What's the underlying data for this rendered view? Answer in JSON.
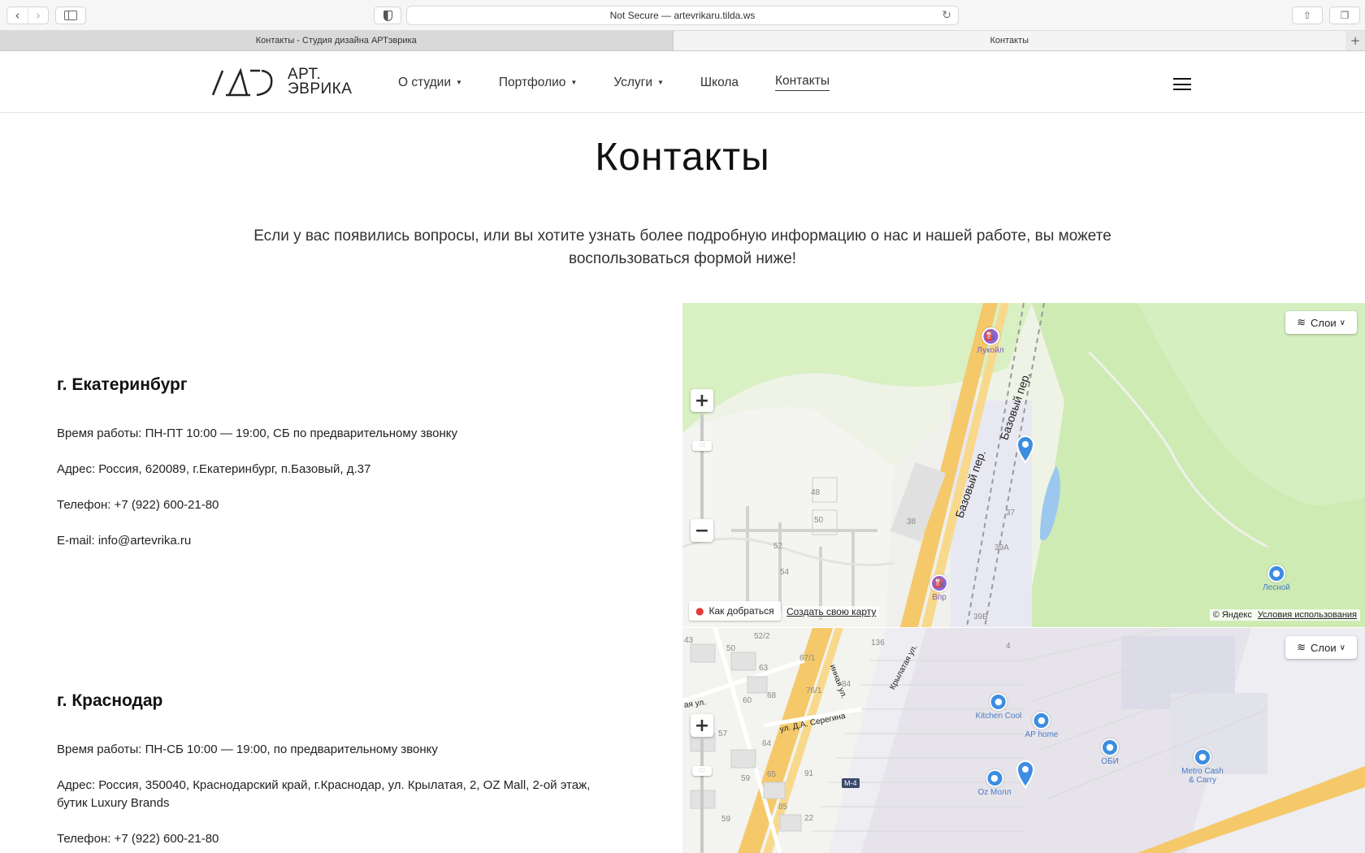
{
  "browser": {
    "url_text": "Not Secure — artevrikaru.tilda.ws",
    "tabs": [
      {
        "label": "Контакты - Студия дизайна АРТэврика",
        "active": false
      },
      {
        "label": "Контакты",
        "active": true
      }
    ],
    "new_tab": "+"
  },
  "header": {
    "logo_line1": "АРТ.",
    "logo_line2": "ЭВРИКА",
    "menu": [
      {
        "label": "О студии",
        "caret": "▼"
      },
      {
        "label": "Портфолио",
        "caret": "▼"
      },
      {
        "label": "Услуги",
        "caret": "▼"
      },
      {
        "label": "Школа",
        "caret": ""
      },
      {
        "label": "Контакты",
        "caret": ""
      }
    ]
  },
  "page": {
    "title": "Контакты",
    "intro": "Если у вас появились вопросы, или вы хотите узнать более подробную информацию о нас и нашей работе, вы можете воспользоваться формой ниже!"
  },
  "contacts": [
    {
      "city": "г. Екатеринбург",
      "hours": "Время работы: ПН-ПТ 10:00 — 19:00, СБ по предварительному звонку",
      "address": "Адрес: Россия, 620089, г.Екатеринбург, п.Базовый, д.37",
      "phone": "Телефон: +7 (922) 600-21-80",
      "email": "E-mail: info@artevrika.ru"
    },
    {
      "city": "г. Краснодар",
      "hours": "Время работы: ПН-СБ 10:00 — 19:00, по предварительному звонку",
      "address": "Адрес: Россия, 350040, Краснодарский край, г.Краснодар, ул. Крылатая, 2, OZ Mall, 2-ой этаж, бутик Luxury Brands",
      "phone": "Телефон: +7 (922) 600-21-80"
    }
  ],
  "map1": {
    "layers": "Слои",
    "route": "Как добраться",
    "create": "Создать свою карту",
    "copyright": "© Яндекс",
    "terms": "Условия использования",
    "streets": [
      "Базовый пер.",
      "Базовый пер."
    ],
    "pois": [
      "Лукойл",
      "Впр",
      "Лесной"
    ],
    "houses": [
      "48",
      "50",
      "38",
      "52",
      "54",
      "37",
      "39А",
      "39Б"
    ]
  },
  "map2": {
    "layers": "Слои",
    "streets": [
      "Крылатая ул.",
      "ул. Д.А. Серегина",
      "инная ул.",
      "ая ул."
    ],
    "pois": [
      "Kitchen Cool",
      "AP home",
      "ОБИ",
      "Metro Cash & Carry",
      "Oz Молл"
    ],
    "road": "М-4",
    "houses": [
      "43",
      "50",
      "52/2",
      "67/1",
      "136",
      "4",
      "63",
      "76/1",
      "84",
      "60",
      "68",
      "57",
      "64",
      "59",
      "65",
      "91",
      "85",
      "22",
      "59"
    ]
  }
}
